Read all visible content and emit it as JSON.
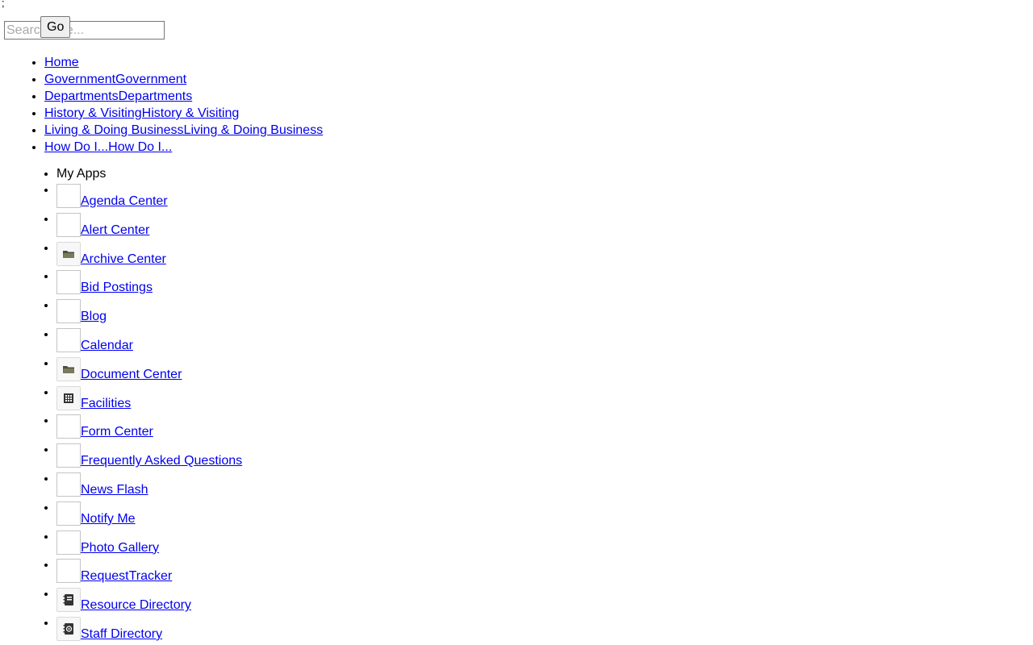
{
  "stray_text": ";",
  "search": {
    "placeholder": "Search Site...",
    "go_label": "Go"
  },
  "main_nav": [
    {
      "label": "Home"
    },
    {
      "label": "GovernmentGovernment"
    },
    {
      "label": "DepartmentsDepartments"
    },
    {
      "label": "History & VisitingHistory & Visiting"
    },
    {
      "label": "Living & Doing BusinessLiving & Doing Business"
    },
    {
      "label": "How Do I...How Do I..."
    }
  ],
  "my_apps": {
    "header": "My Apps",
    "items": [
      {
        "label": "Agenda Center",
        "icon": "broken-image-icon"
      },
      {
        "label": "Alert Center",
        "icon": "broken-image-icon"
      },
      {
        "label": "Archive Center",
        "icon": "folder-icon"
      },
      {
        "label": "Bid Postings",
        "icon": "broken-image-icon"
      },
      {
        "label": "Blog",
        "icon": "broken-image-icon"
      },
      {
        "label": "Calendar",
        "icon": "broken-image-icon"
      },
      {
        "label": "Document Center",
        "icon": "folder-icon"
      },
      {
        "label": "Facilities",
        "icon": "building-icon"
      },
      {
        "label": "Form Center",
        "icon": "broken-image-icon"
      },
      {
        "label": "Frequently Asked Questions",
        "icon": "broken-image-icon"
      },
      {
        "label": "News Flash",
        "icon": "broken-image-icon"
      },
      {
        "label": "Notify Me",
        "icon": "broken-image-icon"
      },
      {
        "label": "Photo Gallery",
        "icon": "broken-image-icon"
      },
      {
        "label": "RequestTracker",
        "icon": "broken-image-icon"
      },
      {
        "label": "Resource Directory",
        "icon": "address-book-icon"
      },
      {
        "label": "Staff Directory",
        "icon": "contact-book-icon"
      }
    ]
  },
  "colors": {
    "link": "#0000ee",
    "icon_glyph": "#4d4d40"
  }
}
